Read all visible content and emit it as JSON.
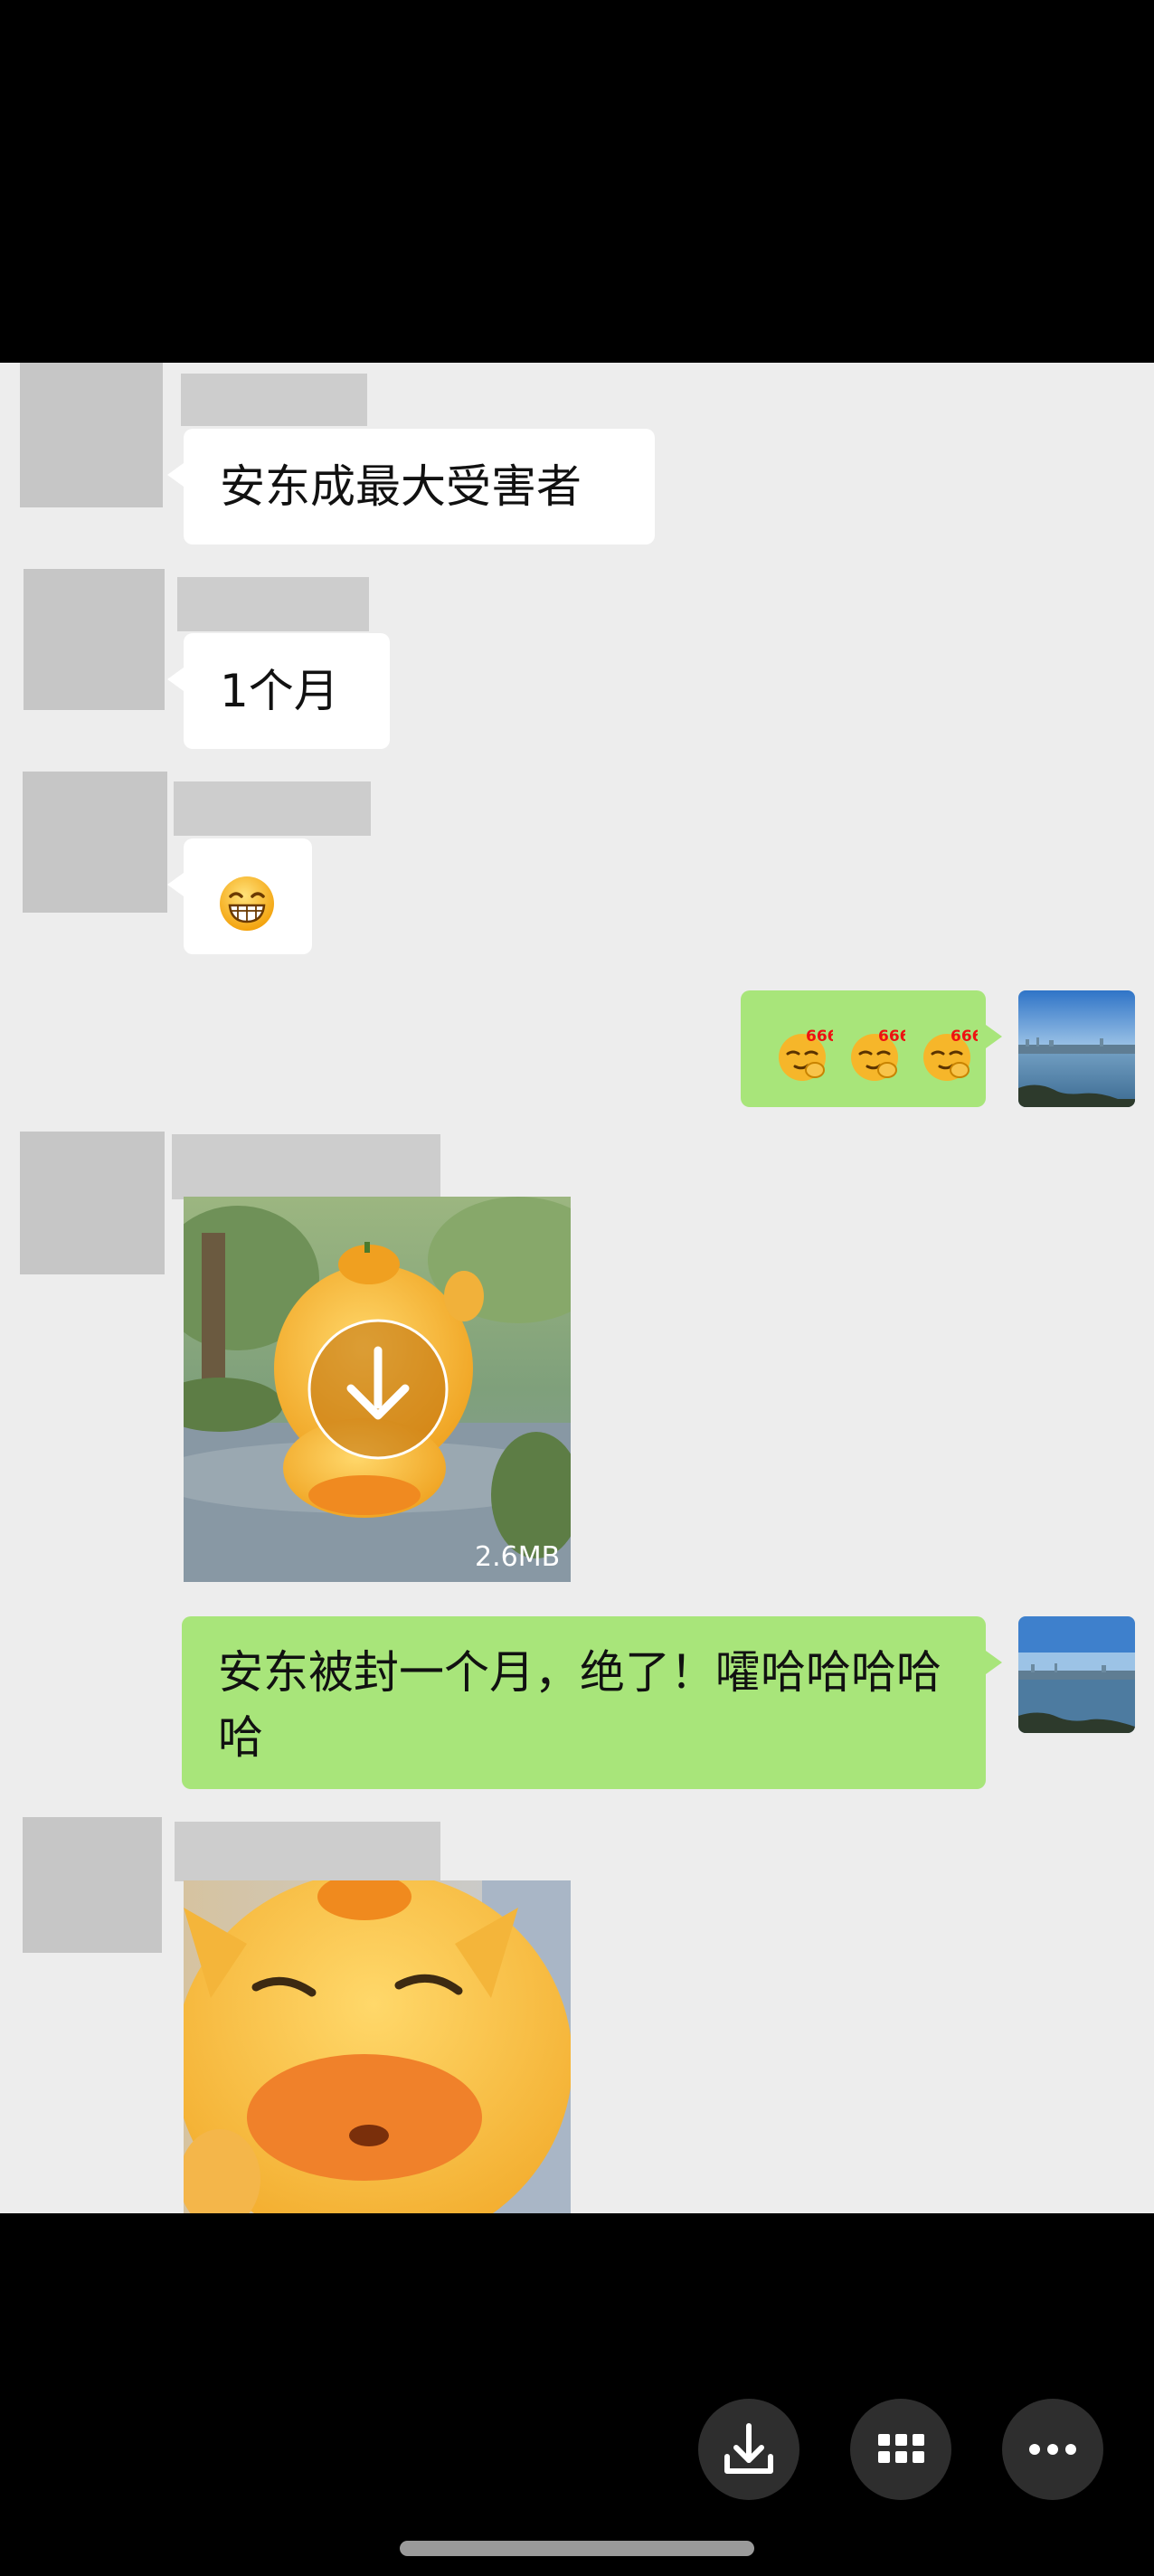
{
  "messages": [
    {
      "direction": "in",
      "type": "text",
      "text": "安东成最大受害者"
    },
    {
      "direction": "in",
      "type": "text",
      "text": "1个月"
    },
    {
      "direction": "in",
      "type": "emoji",
      "emoji": "grin-emoji"
    },
    {
      "direction": "out",
      "type": "emoji",
      "emoji_label": "666",
      "count": 3
    },
    {
      "direction": "in",
      "type": "image",
      "download_icon": "download-arrow-icon",
      "size_label": "2.6MB"
    },
    {
      "direction": "out",
      "type": "text",
      "text": "安东被封一个月，绝了！嚯哈哈哈哈哈"
    },
    {
      "direction": "in",
      "type": "image",
      "subject": "annoyed yellow cartoon character"
    }
  ],
  "toolbar": {
    "buttons": [
      {
        "name": "download-icon"
      },
      {
        "name": "grid-icon"
      },
      {
        "name": "more-icon"
      }
    ]
  },
  "colors": {
    "chat_background": "#ededed",
    "outgoing_bubble": "#a8e57a",
    "incoming_bubble": "#ffffff",
    "screen_background": "#000000"
  }
}
